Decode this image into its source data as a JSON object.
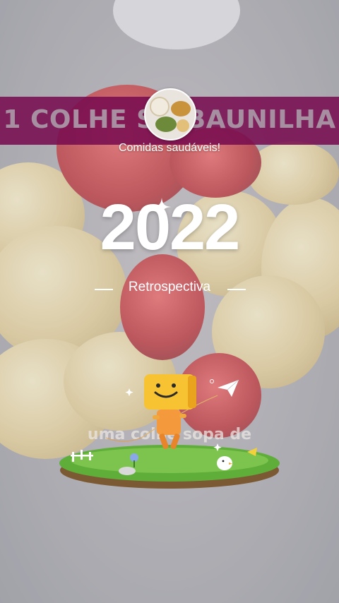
{
  "banner": {
    "text": "1 COLHE SO  BAUNILHA"
  },
  "channel": {
    "name": "Comidas saudáveis!"
  },
  "recap": {
    "year": "2022",
    "label": "Retrospectiva"
  },
  "caption": {
    "text": "uma colhe   sopa de"
  },
  "icons": {
    "avatar": "channel-avatar",
    "sparkle": "sparkle-icon",
    "mascot": "mascot-illustration",
    "plane": "paper-plane-icon"
  },
  "colors": {
    "banner": "#780c50",
    "text": "#ffffff",
    "grass": "#5fae3a"
  }
}
